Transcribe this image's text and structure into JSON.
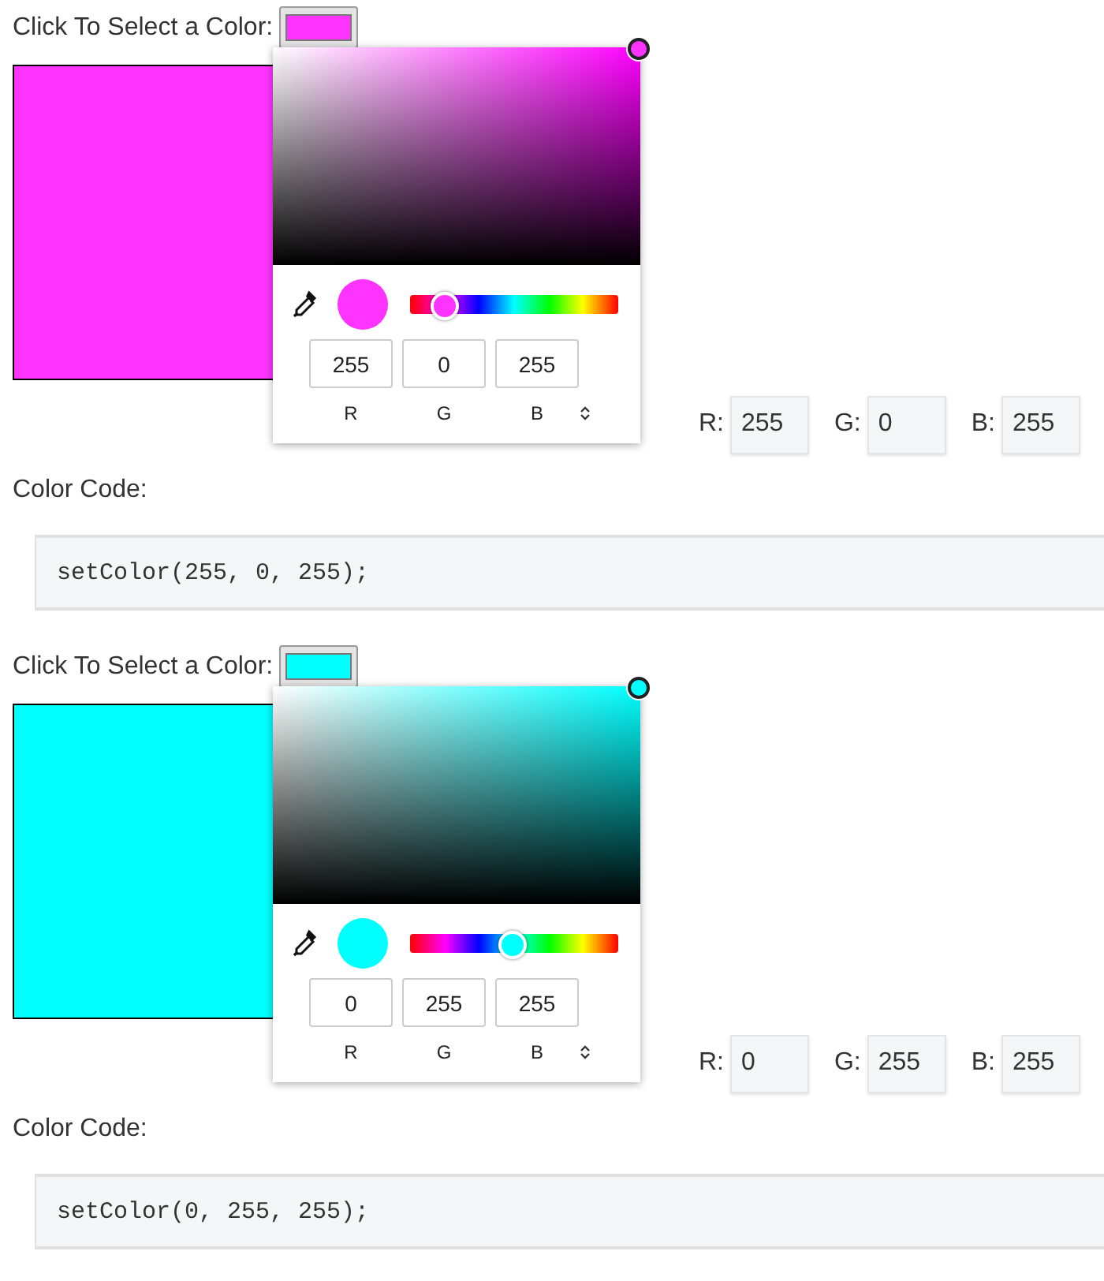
{
  "sections": [
    {
      "prompt": "Click To Select a Color:",
      "color": "#ff33ff",
      "picker": {
        "hue_slider": {
          "level": 0.17
        },
        "values": [
          "255",
          "0",
          "255"
        ],
        "channel_labels": [
          "R",
          "G",
          "B"
        ]
      },
      "fields": [
        {
          "label": "R:",
          "value": "255"
        },
        {
          "label": "G:",
          "value": "0"
        },
        {
          "label": "B:",
          "value": "255"
        }
      ],
      "code_label": "Color Code:",
      "code": "setColor(255, 0, 255);"
    },
    {
      "prompt": "Click To Select a Color:",
      "color": "#00ffff",
      "picker": {
        "hue_slider": {
          "level": 0.49
        },
        "values": [
          "0",
          "255",
          "255"
        ],
        "channel_labels": [
          "R",
          "G",
          "B"
        ]
      },
      "fields": [
        {
          "label": "R:",
          "value": "0"
        },
        {
          "label": "G:",
          "value": "255"
        },
        {
          "label": "B:",
          "value": "255"
        }
      ],
      "code_label": "Color Code:",
      "code": "setColor(0, 255, 255);"
    }
  ]
}
